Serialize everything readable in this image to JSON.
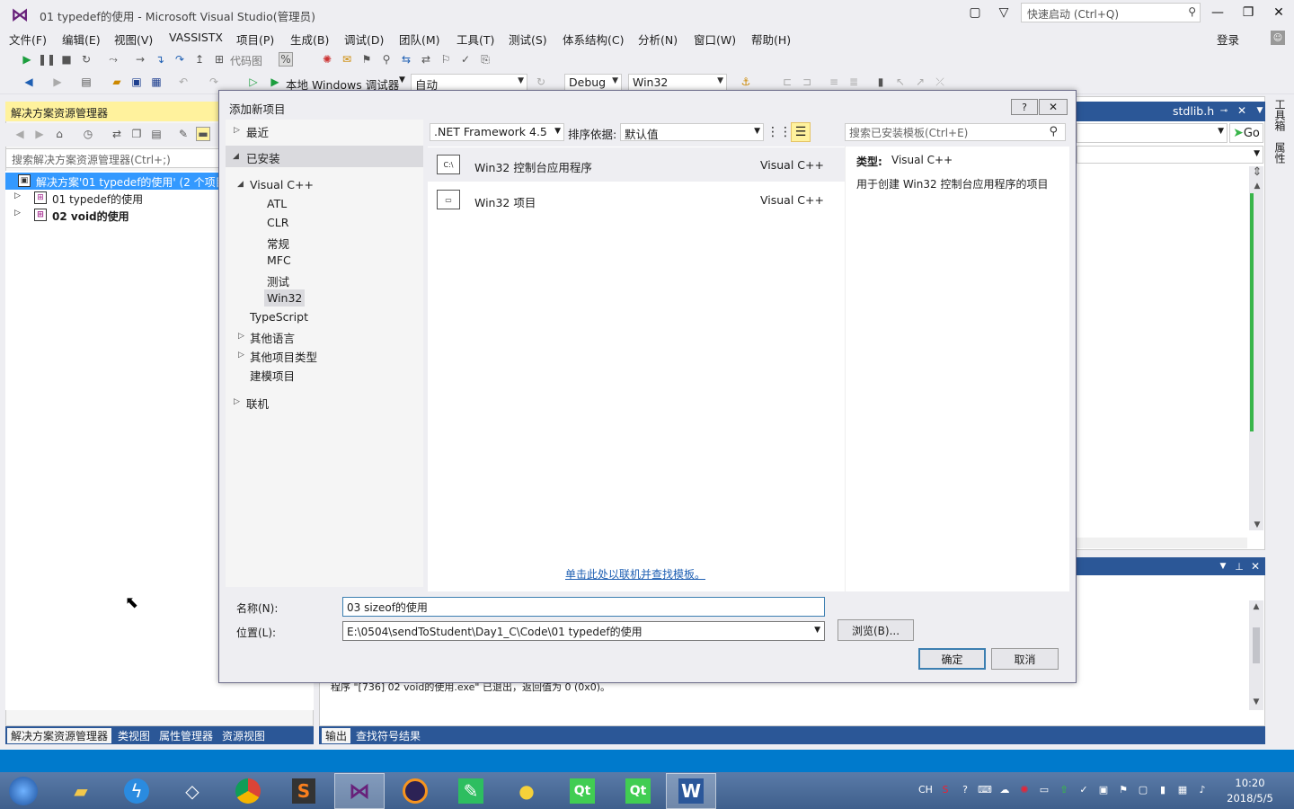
{
  "window": {
    "title": "01 typedef的使用 - Microsoft Visual Studio(管理员)",
    "quick_launch_placeholder": "快速启动 (Ctrl+Q)",
    "sign_in": "登录"
  },
  "menu": [
    "文件(F)",
    "编辑(E)",
    "视图(V)",
    "VASSISTX",
    "项目(P)",
    "生成(B)",
    "调试(D)",
    "团队(M)",
    "工具(T)",
    "测试(S)",
    "体系结构(C)",
    "分析(N)",
    "窗口(W)",
    "帮助(H)"
  ],
  "toolbar": {
    "code_map": "代码图",
    "debugger": "本地 Windows 调试器",
    "auto_combo": "自动",
    "config_combo": "Debug",
    "platform_combo": "Win32"
  },
  "solution_explorer": {
    "title": "解决方案资源管理器",
    "search_placeholder": "搜索解决方案资源管理器(Ctrl+;)",
    "items": [
      {
        "label": "解决方案'01 typedef的使用' (2 个项目"
      },
      {
        "label": "01 typedef的使用"
      },
      {
        "label": "02 void的使用"
      }
    ]
  },
  "left_bottom_tabs": [
    "解决方案资源管理器",
    "类视图",
    "属性管理器",
    "资源视图"
  ],
  "editor": {
    "tab": "stdlib.h",
    "go_button": "Go"
  },
  "side_tabs": [
    "工具箱",
    "属性"
  ],
  "output": {
    "text": "程序 \"[736] 02 void的使用.exe\" 已退出，返回值为 0 (0x0)。"
  },
  "right_bottom_tabs": [
    "输出",
    "查找符号结果"
  ],
  "dialog": {
    "title": "添加新项目",
    "help": "?",
    "nav": {
      "recent": "最近",
      "installed": "已安装",
      "visual_cpp": "Visual C++",
      "sub": [
        "ATL",
        "CLR",
        "常规",
        "MFC",
        "测试",
        "Win32"
      ],
      "typescript": "TypeScript",
      "other_lang": "其他语言",
      "other_types": "其他项目类型",
      "modeling": "建模项目",
      "online": "联机"
    },
    "framework": ".NET Framework 4.5",
    "sort_label": "排序依据:",
    "sort_value": "默认值",
    "search_placeholder": "搜索已安装模板(Ctrl+E)",
    "templates": [
      {
        "name": "Win32 控制台应用程序",
        "lang": "Visual C++"
      },
      {
        "name": "Win32 项目",
        "lang": "Visual C++"
      }
    ],
    "detail": {
      "type_label": "类型:",
      "type_value": "Visual C++",
      "description": "用于创建 Win32 控制台应用程序的项目"
    },
    "online_link": "单击此处以联机并查找模板。",
    "name_label": "名称(N):",
    "name_value": "03 sizeof的使用",
    "location_label": "位置(L):",
    "location_value": "E:\\0504\\sendToStudent\\Day1_C\\Code\\01 typedef的使用",
    "browse": "浏览(B)...",
    "ok": "确定",
    "cancel": "取消"
  },
  "taskbar": {
    "apps": [
      "start",
      "explorer",
      "thunder",
      "unity",
      "chrome",
      "sublime",
      "visual-studio",
      "eclipse",
      "evernote",
      "snail",
      "qt-creator",
      "qt-designer",
      "word"
    ],
    "ime": "CH",
    "time": "10:20",
    "date": "2018/5/5"
  }
}
